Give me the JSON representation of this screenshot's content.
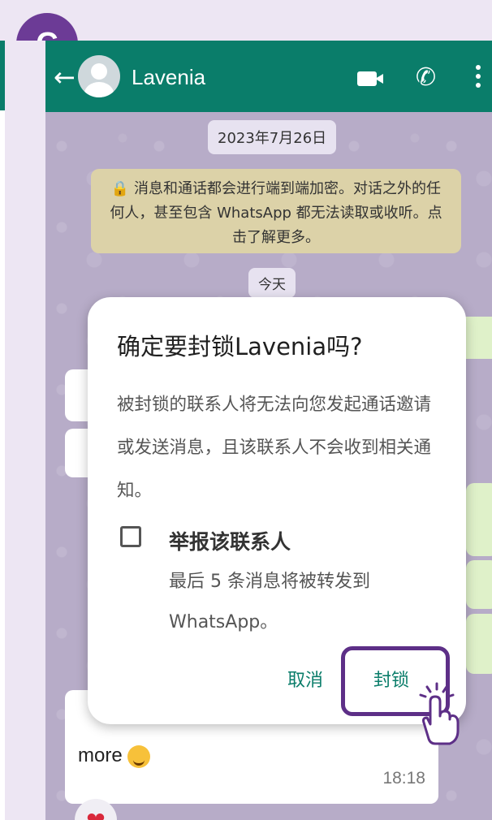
{
  "badge": {
    "label": "C"
  },
  "appbar": {
    "contact_name": "Lavenia"
  },
  "chat": {
    "date_chip": "2023年7月26日",
    "encryption_notice": "🔒 消息和通话都会进行端到端加密。对话之外的任何人，甚至包含 WhatsApp 都无法读取或收听。点击了解更多。",
    "today_chip": "今天",
    "last_message": {
      "text": "more",
      "time": "18:18"
    },
    "reaction": "❤"
  },
  "dialog": {
    "title": "确定要封锁Lavenia吗?",
    "body": "被封锁的联系人将无法向您发起通话邀请或发送消息，且该联系人不会收到相关通知。",
    "checkbox_label": "举报该联系人",
    "checkbox_desc": "最后 5 条消息将被转发到WhatsApp。",
    "cancel_label": "取消",
    "block_label": "封锁"
  },
  "colors": {
    "header": "#0a7d6a",
    "accent": "#0a7d6a",
    "highlight": "#5d2f87"
  }
}
